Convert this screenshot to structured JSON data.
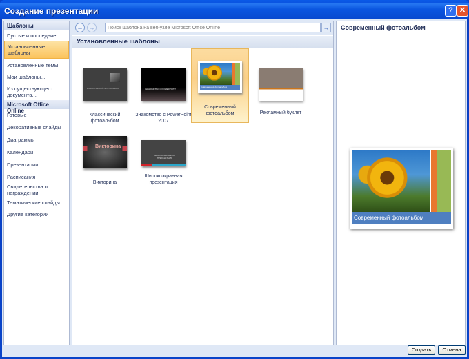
{
  "window": {
    "title": "Создание презентации",
    "help": "?",
    "close": "✕"
  },
  "sidebar": {
    "header1": "Шаблоны",
    "items1": [
      "Пустые и последние",
      "Установленные шаблоны",
      "Установленные темы",
      "Мои шаблоны...",
      "Из существующего документа..."
    ],
    "header2": "Microsoft Office Online",
    "items2": [
      "Готовые",
      "Декоративные слайды",
      "Диаграммы",
      "Календари",
      "Презентации",
      "Расписания",
      "Свидетельства о награждении",
      "Тематические слайды",
      "Другие категории"
    ]
  },
  "nav": {
    "back": "←",
    "forward": "→",
    "search_placeholder": "Поиск шаблона на веб-узле Microsoft Office Online",
    "go": "→"
  },
  "main": {
    "heading": "Установленные шаблоны",
    "templates": [
      {
        "label": "Классический фотоальбом",
        "thumb_text": "КЛАССИЧЕСКИЙ ФОТОАЛЬБОМ"
      },
      {
        "label": "Знакомство с PowerPoint 2007",
        "thumb_text": "ЗНАКОМСТВО С POWERPOINT"
      },
      {
        "label": "Современный фотоальбом",
        "thumb_text": "Современный фотоальбом"
      },
      {
        "label": "Рекламный буклет",
        "thumb_text": ""
      },
      {
        "label": "Викторина",
        "thumb_text": "Викторина"
      },
      {
        "label": "Широкоэкранная презентация",
        "thumb_text": "ШИРОКОЭКРАННАЯ ПРЕЗЕНТАЦИЯ"
      }
    ]
  },
  "preview": {
    "title": "Современный фотоальбом",
    "caption": "Современный фотоальбом"
  },
  "buttons": {
    "create": "Создать",
    "cancel": "Отмена"
  }
}
